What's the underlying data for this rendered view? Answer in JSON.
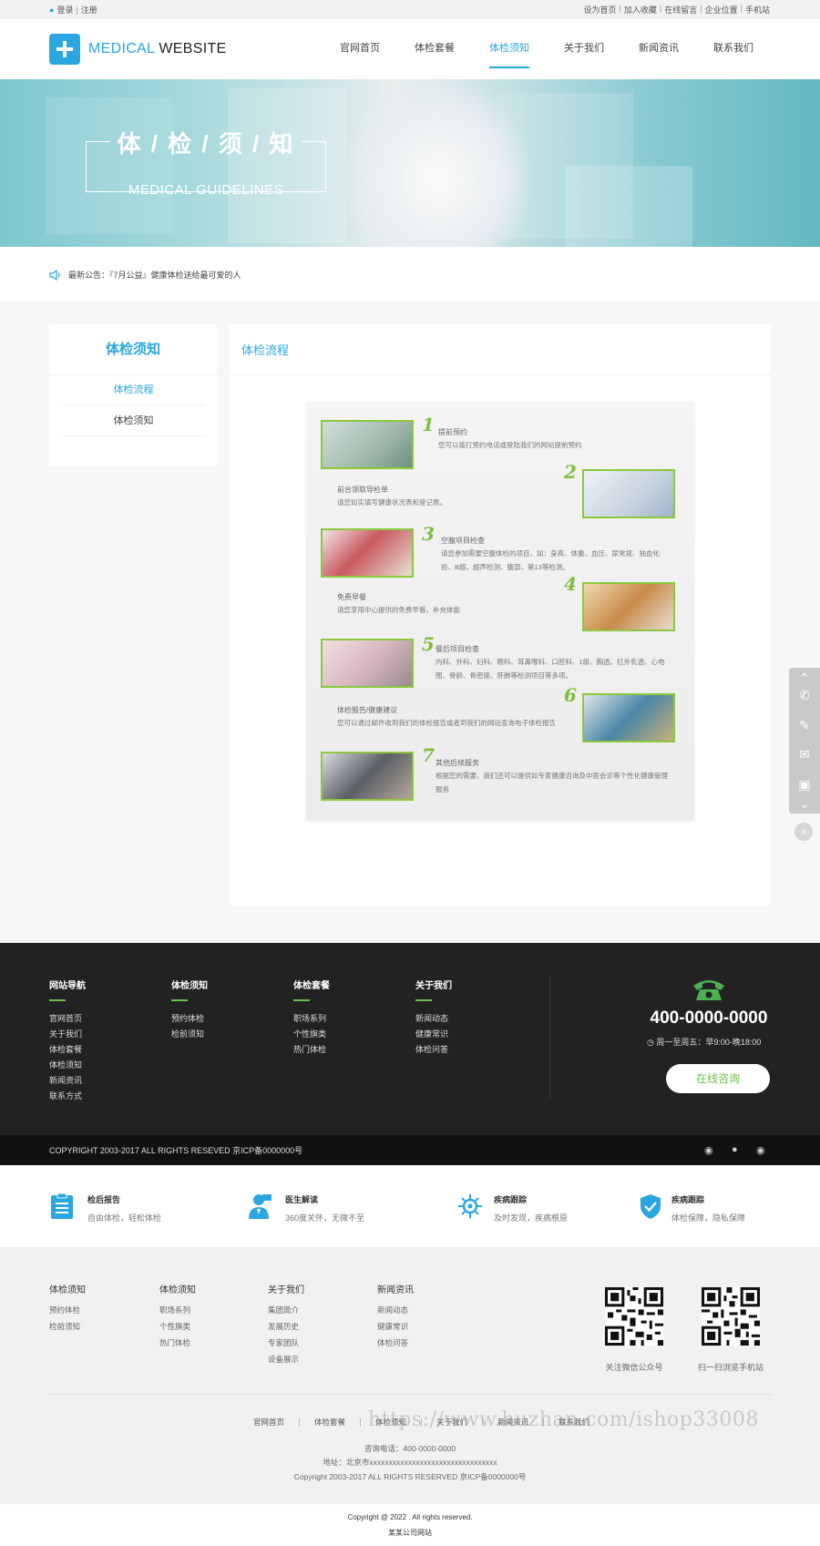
{
  "topbar": {
    "login": "登录",
    "register": "注册",
    "links": [
      "设为首页",
      "加入收藏",
      "在线留言",
      "企业位置",
      "手机站"
    ]
  },
  "logo": {
    "part1": "MEDICAL",
    "part2": "WEBSITE"
  },
  "nav": {
    "items": [
      "官网首页",
      "体检套餐",
      "体检须知",
      "关于我们",
      "新闻资讯",
      "联系我们"
    ],
    "active_index": 2
  },
  "banner": {
    "title": "体 / 检 / 须 / 知",
    "subtitle": "MEDICAL GUIDELINES"
  },
  "notice": {
    "text": "最新公告：『7月公益』健康体检送给最可爱的人"
  },
  "sidebar": {
    "title": "体检须知",
    "items": [
      "体检流程",
      "体检须知"
    ]
  },
  "main": {
    "title": "体检流程"
  },
  "process": {
    "steps": [
      {
        "num": "1",
        "title": "提前预约",
        "desc": "您可以拨打预约电话或登陆我们的网站提前预约"
      },
      {
        "num": "2",
        "title": "前台领取导检单",
        "desc": "请您如实填写健康状况表和登记表。"
      },
      {
        "num": "3",
        "title": "空腹项目检查",
        "desc": "请您参加需要空腹体检的项目，如：身高、体重、血压、尿常规、抽血化验、B超、超声检测、腹部、第13等检测。"
      },
      {
        "num": "4",
        "title": "免费早餐",
        "desc": "请您享用中心提供的免费早餐，补充体能"
      },
      {
        "num": "5",
        "title": "餐后项目检查",
        "desc": "内科、外科、妇科、眼科、耳鼻喉科、口腔科、1级、胸透、红外乳透、心电图、骨龄、骨密度、肝肺等检测项目等多项。"
      },
      {
        "num": "6",
        "title": "体检报告/健康建议",
        "desc": "您可以通过邮件收到我们的体检报告或者到我们的网站查询电子体检报告"
      },
      {
        "num": "7",
        "title": "其他后续服务",
        "desc": "根据您的需要，我们还可以提供如专家健康咨询及中医会诊等个性化健康管理服务"
      }
    ]
  },
  "footer": {
    "columns": [
      {
        "title": "网站导航",
        "links": [
          "官网首页",
          "关于我们",
          "体检套餐",
          "体检须知",
          "新闻资讯",
          "联系方式"
        ]
      },
      {
        "title": "体检须知",
        "links": [
          "预约体检",
          "检前须知"
        ]
      },
      {
        "title": "体检套餐",
        "links": [
          "职场系列",
          "个性旗类",
          "热门体检"
        ]
      },
      {
        "title": "关于我们",
        "links": [
          "新闻动态",
          "健康常识",
          "体检问答"
        ]
      }
    ],
    "phone": "400-0000-0000",
    "hours": "周一至周五：早9:00-晚18:00",
    "consult_label": "在线咨询",
    "copyright": "COPYRIGHT 2003-2017 ALL RIGHTS RESEVED 京ICP备0000000号",
    "accent": "#6bc04b"
  },
  "features": [
    {
      "title": "检后报告",
      "desc": "自由体检，轻松体检",
      "icon": "clipboard-icon"
    },
    {
      "title": "医生解读",
      "desc": "360度关怀，无微不至",
      "icon": "doctor-icon"
    },
    {
      "title": "疾病跟踪",
      "desc": "及时发现，疾病根原",
      "icon": "virus-icon"
    },
    {
      "title": "疾病跟踪",
      "desc": "体检保障，隐私保障",
      "icon": "shield-check-icon"
    }
  ],
  "lower": {
    "columns": [
      {
        "title": "体检须知",
        "links": [
          "预约体检",
          "检前须知"
        ]
      },
      {
        "title": "体检须知",
        "links": [
          "职场系列",
          "个性旗类",
          "热门体检"
        ]
      },
      {
        "title": "关于我们",
        "links": [
          "集团简介",
          "发展历史",
          "专家团队",
          "设备展示"
        ]
      },
      {
        "title": "新闻资讯",
        "links": [
          "新闻动态",
          "健康常识",
          "体检问答"
        ]
      }
    ],
    "qr": [
      {
        "label": "关注微信公众号"
      },
      {
        "label": "扫一扫浏览手机站"
      }
    ],
    "bottom_nav": [
      "官网首页",
      "体检套餐",
      "体检须知",
      "关于我们",
      "新闻资讯",
      "联系我们"
    ],
    "contact_phone": "咨询电话：400-0000-0000",
    "address": "地址：北京市xxxxxxxxxxxxxxxxxxxxxxxxxxxxxxxxx",
    "copyright": "Copyright 2003-2017 ALL RIGHTS RESERVED 京ICP备0000000号",
    "watermark": "https://www.huzhan.com/ishop33008"
  },
  "very_bottom": {
    "copyright": "Copyright @ 2022 . All rights reserved.",
    "company": "某某公司网站"
  },
  "colors": {
    "brand": "#2aa6e0",
    "dark": "#222222"
  }
}
